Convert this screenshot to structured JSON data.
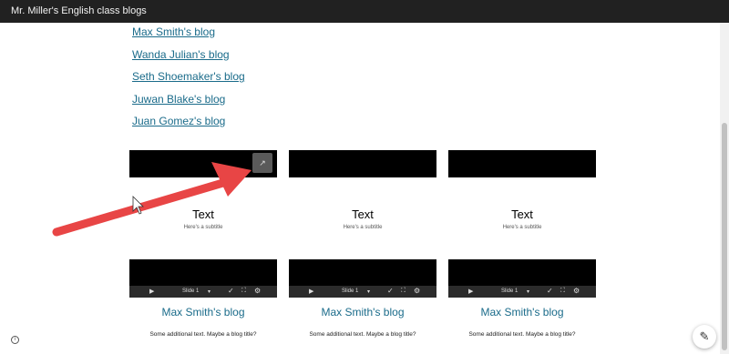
{
  "header": {
    "title": "Mr. Miller's English class blogs"
  },
  "links": [
    "Max Smith's blog",
    "Wanda Julian's blog",
    "Seth Shoemaker's blog",
    "Juwan Blake's blog",
    "Juan Gomez's blog"
  ],
  "cards": [
    {
      "slide_title": "Text",
      "slide_subtitle": "Here's a subtitle",
      "slide_number": "Slide 1",
      "title": "Max Smith's blog",
      "subtitle": "Some additional text. Maybe a blog title?"
    },
    {
      "slide_title": "Text",
      "slide_subtitle": "Here's a subtitle",
      "slide_number": "Slide 1",
      "title": "Max Smith's blog",
      "subtitle": "Some additional text. Maybe a blog title?"
    },
    {
      "slide_title": "Text",
      "slide_subtitle": "Here's a subtitle",
      "slide_number": "Slide 1",
      "title": "Max Smith's blog",
      "subtitle": "Some additional text. Maybe a blog title?"
    }
  ],
  "icons": {
    "play": "play-icon",
    "dropdown": "chevron-down-icon",
    "edit": "edit-icon",
    "fullscreen": "fullscreen-icon",
    "settings": "gear-icon",
    "popout": "open-in-new-icon",
    "info": "info-icon",
    "fab": "pencil-icon"
  },
  "colors": {
    "link": "#1a6b8a",
    "header_bg": "#212121",
    "annotation_arrow": "#e84545"
  }
}
